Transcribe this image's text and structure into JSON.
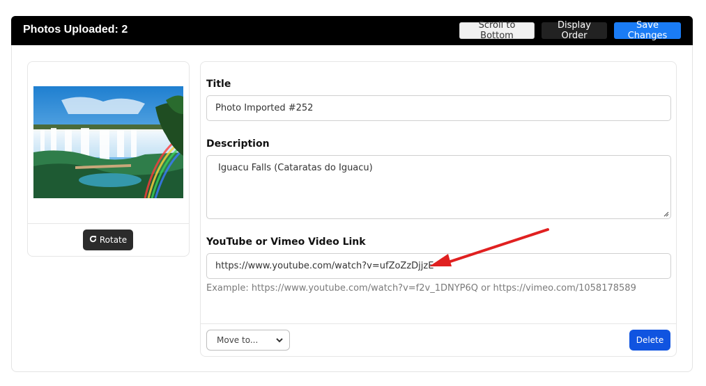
{
  "header": {
    "title": "Photos Uploaded: 2",
    "scroll_label": "Scroll to Bottom",
    "order_label": "Display Order",
    "save_label": "Save Changes"
  },
  "photo": {
    "rotate_label": "Rotate",
    "rotate_icon": "rotate-cw-icon"
  },
  "form": {
    "title_label": "Title",
    "title_value": "Photo Imported #252",
    "description_label": "Description",
    "description_value": "Iguacu Falls (Cataratas do Iguacu)",
    "video_label": "YouTube or Vimeo Video Link",
    "video_value": "https://www.youtube.com/watch?v=ufZoZzDjjzE",
    "video_hint": "Example: https://www.youtube.com/watch?v=f2v_1DNYP6Q or https://vimeo.com/1058178589",
    "move_label": "Move to...",
    "delete_label": "Delete"
  },
  "colors": {
    "header_bg": "#000000",
    "save_button": "#1a7cf5",
    "delete_button": "#1054e0",
    "annotation_arrow": "#e02020"
  }
}
